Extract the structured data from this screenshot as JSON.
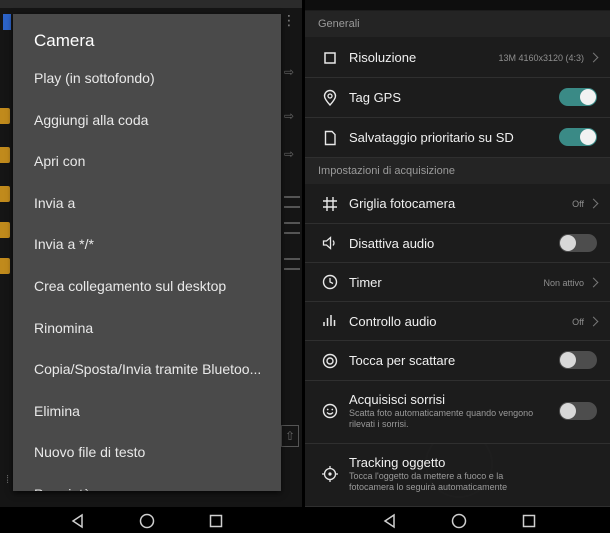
{
  "left_menu": {
    "title": "Camera",
    "items": [
      "Play (in sottofondo)",
      "Aggiungi alla coda",
      "Apri con",
      "Invia a",
      "Invia a */*",
      "Crea collegamento sul desktop",
      "Rinomina",
      "Copia/Sposta/Invia tramite Bluetoo...",
      "Elimina",
      "Nuovo file di testo",
      "Proprietà"
    ]
  },
  "settings": {
    "section_general": "Generali",
    "section_capture": "Impostazioni di acquisizione",
    "rows": {
      "resolution": {
        "label": "Risoluzione",
        "value": "13M 4160x3120 (4:3)"
      },
      "gps": {
        "label": "Tag GPS",
        "checked": true
      },
      "sd": {
        "label": "Salvataggio prioritario su SD",
        "checked": true
      },
      "grid": {
        "label": "Griglia fotocamera",
        "value": "Off"
      },
      "mute": {
        "label": "Disattiva audio",
        "checked": false
      },
      "timer": {
        "label": "Timer",
        "value": "Non attivo"
      },
      "audio": {
        "label": "Controllo audio",
        "value": "Off"
      },
      "touch": {
        "label": "Tocca per scattare",
        "checked": false
      },
      "smile": {
        "label": "Acquisisci sorrisi",
        "sub": "Scatta foto automaticamente quando vengono rilevati i sorrisi.",
        "checked": false
      },
      "tracking": {
        "label": "Tracking oggetto",
        "sub": "Tocca l'oggetto da mettere a fuoco e la fotocamera lo seguirà automaticamente"
      }
    }
  },
  "icons": {
    "resolution": "square-outline-icon",
    "gps": "location-pin-icon",
    "sd": "sd-document-icon",
    "grid": "hash-grid-icon",
    "mute": "speaker-icon",
    "timer": "clock-icon",
    "audio": "audio-bars-icon",
    "touch": "target-circle-icon",
    "smile": "smile-icon",
    "tracking": "crosshair-icon"
  },
  "colors": {
    "toggle_on": "#3a8a86",
    "menu_bg": "#4a4a4a"
  }
}
